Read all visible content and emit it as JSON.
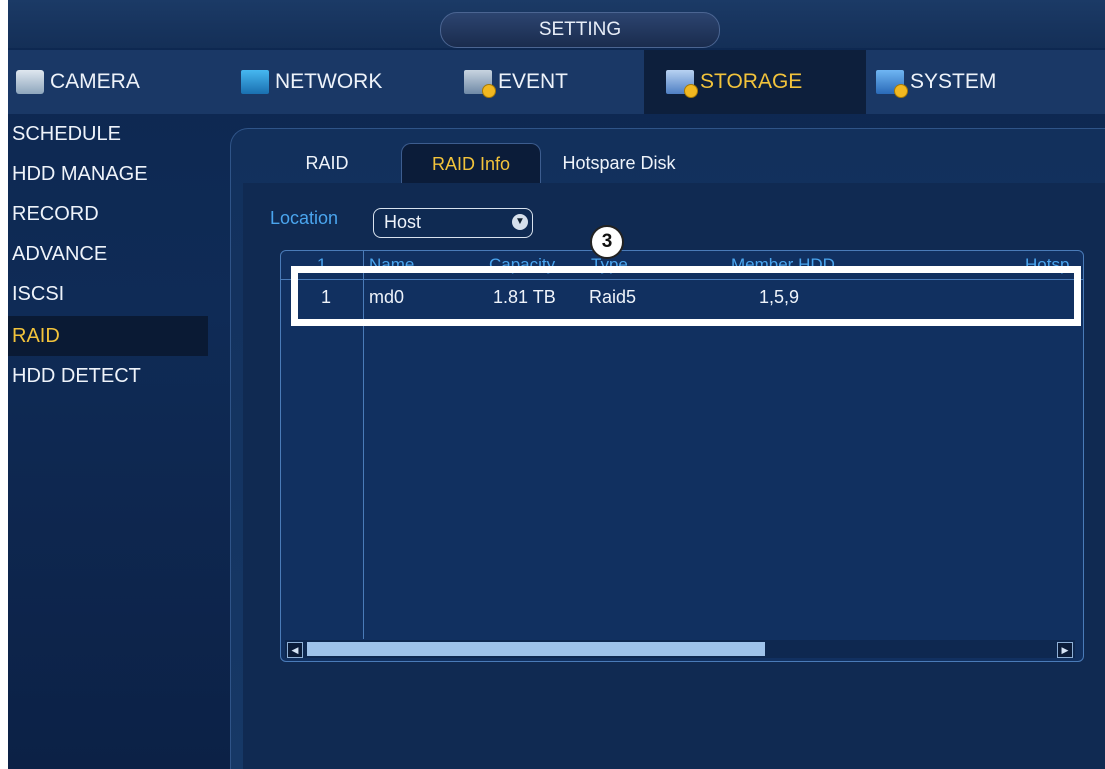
{
  "title": "SETTING",
  "top_tabs": [
    {
      "label": "CAMERA",
      "icon": "camera-icon"
    },
    {
      "label": "NETWORK",
      "icon": "network-icon"
    },
    {
      "label": "EVENT",
      "icon": "event-icon"
    },
    {
      "label": "STORAGE",
      "icon": "storage-icon",
      "active": true
    },
    {
      "label": "SYSTEM",
      "icon": "system-icon"
    }
  ],
  "sidebar": {
    "items": [
      {
        "label": "SCHEDULE"
      },
      {
        "label": "HDD MANAGE"
      },
      {
        "label": "RECORD"
      },
      {
        "label": "ADVANCE"
      },
      {
        "label": "ISCSI"
      },
      {
        "label": "RAID",
        "active": true
      },
      {
        "label": "HDD DETECT"
      }
    ]
  },
  "sub_tabs": [
    {
      "label": "RAID"
    },
    {
      "label": "RAID Info",
      "active": true
    },
    {
      "label": "Hotspare Disk"
    }
  ],
  "location": {
    "label": "Location",
    "value": "Host"
  },
  "marker": "3",
  "table": {
    "headers": [
      "1",
      "Name",
      "Capacity",
      "Type",
      "Member HDD",
      "Hotsp"
    ],
    "rows": [
      [
        "1",
        "md0",
        "1.81 TB",
        "Raid5",
        "1,5,9",
        ""
      ]
    ]
  },
  "colors": {
    "accent": "#f2c33b",
    "header_text": "#4aa5ee",
    "background": "#0f2b56",
    "highlight": "#ffffff"
  }
}
